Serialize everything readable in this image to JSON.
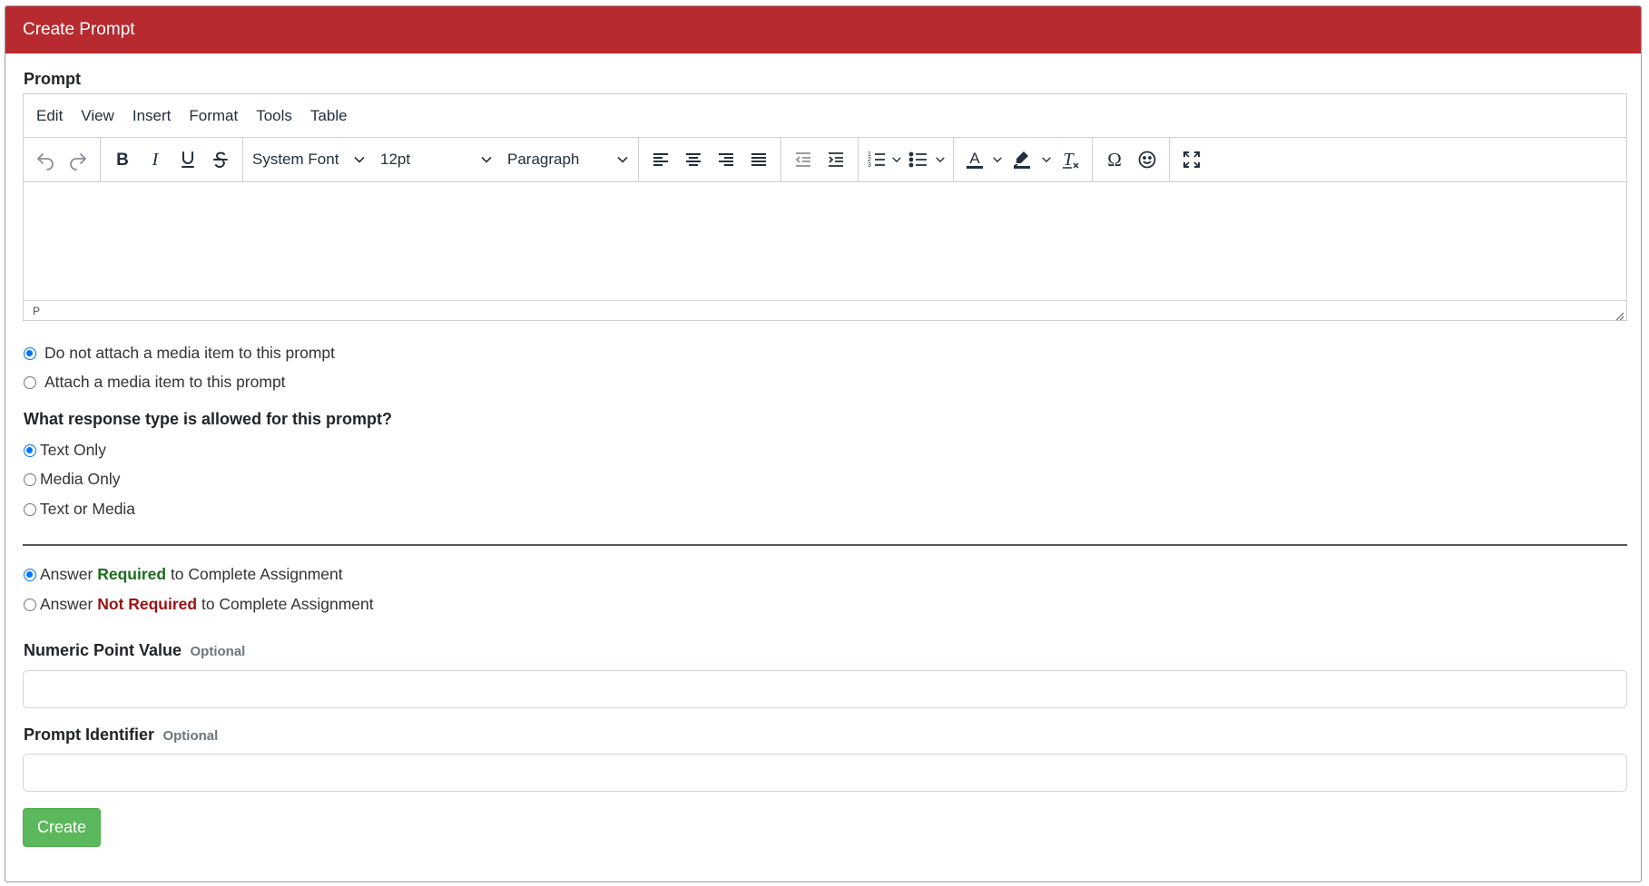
{
  "header": {
    "title": "Create Prompt"
  },
  "prompt": {
    "label": "Prompt",
    "menubar": [
      "Edit",
      "View",
      "Insert",
      "Format",
      "Tools",
      "Table"
    ],
    "font_family": "System Font",
    "font_size": "12pt",
    "block_format": "Paragraph",
    "status_path": "P"
  },
  "media": {
    "options": [
      "Do not attach a media item to this prompt",
      "Attach a media item to this prompt"
    ],
    "selected_index": 0
  },
  "response_type": {
    "question": "What response type is allowed for this prompt?",
    "options": [
      "Text Only",
      "Media Only",
      "Text or Media"
    ],
    "selected_index": 0
  },
  "requirement": {
    "required": {
      "prefix": "Answer ",
      "emphasis": "Required",
      "suffix": " to Complete Assignment"
    },
    "not_required": {
      "prefix": "Answer ",
      "emphasis": "Not Required",
      "suffix": " to Complete Assignment"
    },
    "selected": "required"
  },
  "fields": {
    "point_value": {
      "label": "Numeric Point Value",
      "hint": "Optional",
      "value": ""
    },
    "identifier": {
      "label": "Prompt Identifier",
      "hint": "Optional",
      "value": ""
    }
  },
  "actions": {
    "create_label": "Create"
  },
  "colors": {
    "header_bg": "#b72a2f",
    "required": "#1b6b1b",
    "not_required": "#9b1111",
    "create_button": "#5cb85c",
    "radio_checked": "#0075ff"
  }
}
